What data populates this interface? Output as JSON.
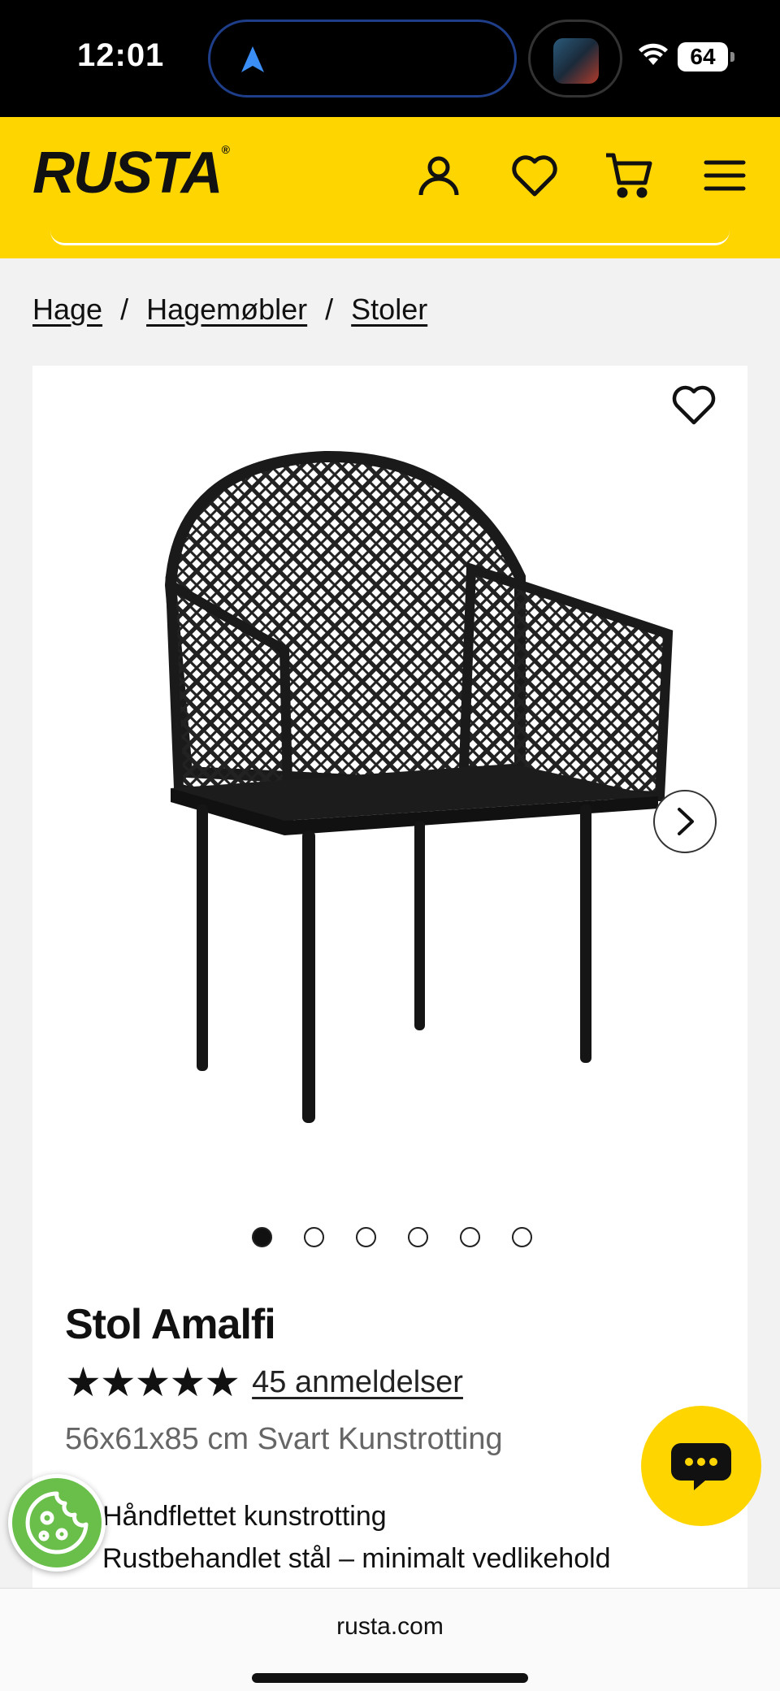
{
  "status_bar": {
    "time": "12:01",
    "battery": "64"
  },
  "header": {
    "logo": "RUSTA",
    "logo_mark": "®"
  },
  "breadcrumb": [
    "Hage",
    "Hagemøbler",
    "Stoler"
  ],
  "product": {
    "title": "Stol Amalfi",
    "stars": "★★★★★",
    "rating": 5,
    "reviews_label": "45 anmeldelser",
    "variant": "56x61x85 cm Svart Kunstrotting",
    "features": [
      "Håndflettet kunstrotting",
      "Rustbehandlet stål – minimalt vedlikehold"
    ],
    "image_count": 6,
    "current_image": 1
  },
  "browser": {
    "url": "rusta.com"
  },
  "colors": {
    "brand_yellow": "#ffd500",
    "cookie_green": "#6abf4b"
  }
}
